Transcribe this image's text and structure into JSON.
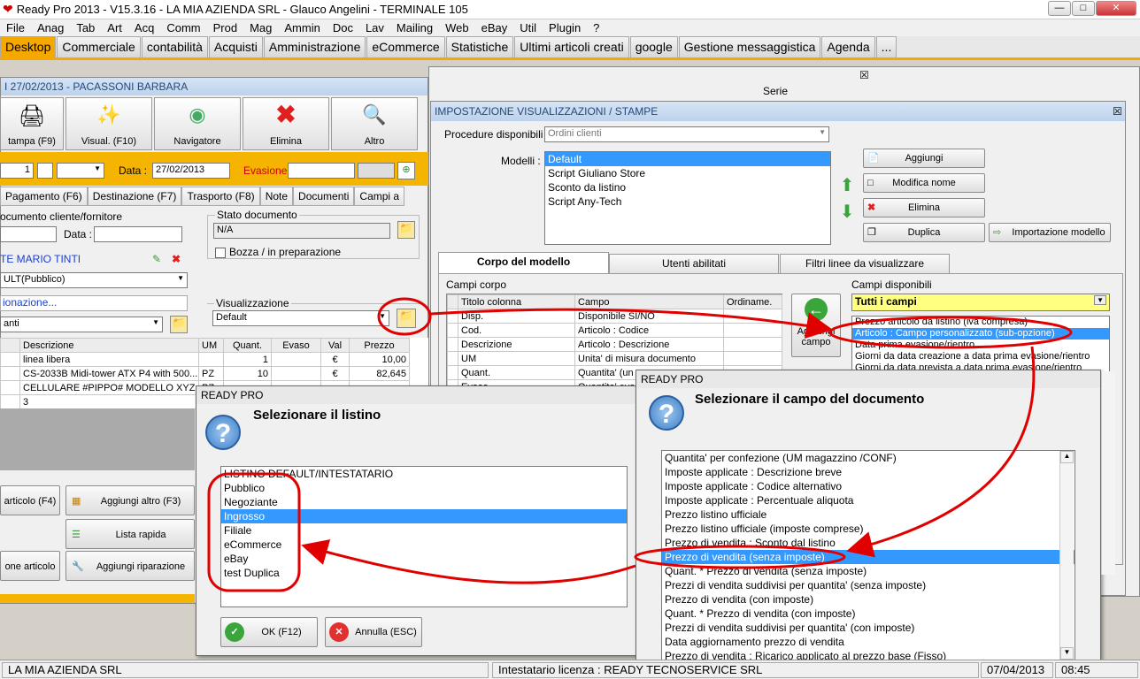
{
  "app": {
    "title": "Ready Pro 2013 - V15.3.16 - LA MIA AZIENDA SRL - Glauco Angelini - TERMINALE 105",
    "window_buttons": [
      "—",
      "□",
      "✕"
    ]
  },
  "menu": [
    "File",
    "Anag",
    "Tab",
    "Art",
    "Acq",
    "Comm",
    "Prod",
    "Mag",
    "Ammin",
    "Doc",
    "Lav",
    "Mailing",
    "Web",
    "eBay",
    "Util",
    "Plugin",
    "?"
  ],
  "tabs": [
    "Desktop",
    "Commerciale",
    "contabilità",
    "Acquisti",
    "Amministrazione",
    "eCommerce",
    "Statistiche",
    "Ultimi articoli creati",
    "google",
    "Gestione messaggistica",
    "Agenda",
    "..."
  ],
  "order": {
    "header": "I 27/02/2013 - PACASSONI BARBARA",
    "toolbar": [
      "tampa (F9)",
      "Visual. (F10)",
      "Navigatore",
      "Elimina",
      "Altro"
    ],
    "number_value": "1",
    "data_label": "Data :",
    "data_value": "27/02/2013",
    "evasione_label": "Evasione:",
    "subtabs": [
      "Pagamento (F6)",
      "Destinazione (F7)",
      "Trasporto (F8)",
      "Note",
      "Documenti",
      "Campi a"
    ],
    "doc_cliente_label": "ocumento cliente/fornitore",
    "data2_label": "Data :",
    "customer": "TE MARIO TINTI",
    "listino": "ULT(Pubblico)",
    "ionazione": "ionazione...",
    "anti": "anti",
    "stato_label": "Stato documento",
    "stato_value": "N/A",
    "bozza_label": "Bozza / in preparazione",
    "visualizzazione_label": "Visualizzazione",
    "visualizzazione_value": "Default",
    "grid_headers": [
      "Descrizione",
      "UM",
      "Quant.",
      "Evaso",
      "Val",
      "Prezzo"
    ],
    "grid_rows": [
      [
        "linea libera",
        "",
        "1",
        "",
        "€",
        "10,00"
      ],
      [
        "CS-2033B Midi-tower ATX P4 with 500...",
        "PZ",
        "10",
        "",
        "€",
        "82,645"
      ],
      [
        "CELLULARE #PIPPO# MODELLO XYZ",
        "PZ",
        "",
        "",
        "",
        ""
      ],
      [
        "3",
        "",
        "",
        "",
        "",
        ""
      ]
    ],
    "bottom_buttons": [
      "articolo (F4)",
      "Aggiungi altro (F3)",
      "Lista rapida",
      "one articolo",
      "Aggiungi riparazione"
    ]
  },
  "bg_window": {
    "serie_label": "Serie"
  },
  "impostazione": {
    "title": "IMPOSTAZIONE VISUALIZZAZIONI / STAMPE",
    "procedure_label": "Procedure disponibili :",
    "procedure_value": "Ordini clienti",
    "modelli_label": "Modelli :",
    "modelli": [
      "Default",
      "Script Giuliano Store",
      "Sconto da listino",
      "Script Any-Tech"
    ],
    "buttons": [
      "Aggiungi",
      "Modifica nome",
      "Elimina",
      "Duplica",
      "Importazione modello"
    ],
    "tabs": [
      "Corpo del modello",
      "Utenti abilitati",
      "Filtri linee da visualizzare"
    ],
    "campi_corpo_label": "Campi corpo",
    "campi_headers": [
      "Titolo colonna",
      "Campo",
      "Ordiname."
    ],
    "campi_rows": [
      [
        "Disp.",
        "Disponibile SI/NO",
        ""
      ],
      [
        "Cod.",
        "Articolo : Codice",
        ""
      ],
      [
        "Descrizione",
        "Articolo : Descrizione",
        ""
      ],
      [
        "UM",
        "Unita' di misura documento",
        ""
      ],
      [
        "Quant.",
        "Quantita' (un",
        ""
      ],
      [
        "Evaso",
        "Quantita' eva",
        ""
      ]
    ],
    "aggiungi_campo": "Aggiungi campo",
    "campi_disponibili_label": "Campi disponibili",
    "filtro_value": "Tutti i campi",
    "disponibili": [
      "Prezzo articolo da listino (iva compresa)",
      "Articolo : Campo personalizzato (sub-opzione)",
      "Data prima evasione/rientro",
      "Giorni da data creazione a data prima evasione/rientro",
      "Giorni da data prevista a data prima evasione/rientro"
    ]
  },
  "dlg_listino": {
    "title": "READY PRO",
    "heading": "Selezionare il listino",
    "items": [
      "LISTINO DEFAULT/INTESTATARIO",
      "Pubblico",
      "Negoziante",
      "Ingrosso",
      "Filiale",
      "eCommerce",
      "eBay",
      "test Duplica"
    ],
    "selected_index": 3,
    "ok": "OK (F12)",
    "annulla": "Annulla (ESC)"
  },
  "dlg_campo": {
    "title": "READY PRO",
    "heading": "Selezionare il campo del documento",
    "items": [
      "Quantita' per confezione (UM magazzino /CONF)",
      "Imposte applicate : Descrizione breve",
      "Imposte applicate : Codice alternativo",
      "Imposte applicate : Percentuale aliquota",
      "Prezzo listino ufficiale",
      "Prezzo listino ufficiale (imposte comprese)",
      "Prezzo di vendita : Sconto dal listino",
      "Prezzo di vendita (senza imposte)",
      "Quant. * Prezzo di vendita (senza imposte)",
      "Prezzi di vendita suddivisi per quantita' (senza imposte)",
      "Prezzo di vendita (con imposte)",
      "Quant. * Prezzo di vendita (con imposte)",
      "Prezzi di vendita suddivisi per quantita' (con imposte)",
      "Data aggiornamento prezzo di vendita",
      "Prezzo di vendita : Ricarico applicato al prezzo base (Fisso)"
    ],
    "selected_index": 7
  },
  "statusbar": {
    "company": "LA MIA AZIENDA SRL",
    "license": "Intestatario licenza : READY TECNOSERVICE SRL",
    "date": "07/04/2013",
    "time": "08:45"
  },
  "colors": {
    "accent": "#f5a800",
    "selection": "#3399ff",
    "annotation": "#e00000"
  }
}
